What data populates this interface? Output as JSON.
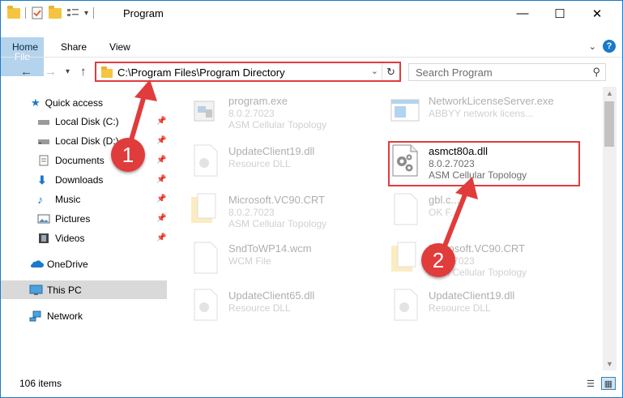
{
  "window": {
    "title": "Program",
    "controls": {
      "minimize": "—",
      "maximize": "☐",
      "close": "✕"
    }
  },
  "ribbon": {
    "tabs": [
      "File",
      "Home",
      "Share",
      "View"
    ],
    "help": "?"
  },
  "navigation": {
    "address_path": "C:\\Program Files\\Program Directory",
    "search_placeholder": "Search Program"
  },
  "sidebar": {
    "items": [
      {
        "label": "Quick access",
        "icon": "star-icon",
        "pinned": false
      },
      {
        "label": "Local Disk (C:)",
        "icon": "drive-icon",
        "pinned": true
      },
      {
        "label": "Local Disk (D:)",
        "icon": "drive-icon",
        "pinned": true
      },
      {
        "label": "Documents",
        "icon": "documents-icon",
        "pinned": true
      },
      {
        "label": "Downloads",
        "icon": "download-icon",
        "pinned": true
      },
      {
        "label": "Music",
        "icon": "music-icon",
        "pinned": true
      },
      {
        "label": "Pictures",
        "icon": "pictures-icon",
        "pinned": true
      },
      {
        "label": "Videos",
        "icon": "videos-icon",
        "pinned": true
      },
      {
        "label": "OneDrive",
        "icon": "cloud-icon",
        "pinned": false
      },
      {
        "label": "This PC",
        "icon": "computer-icon",
        "pinned": false,
        "selected": true
      },
      {
        "label": "Network",
        "icon": "network-icon",
        "pinned": false
      }
    ]
  },
  "files": [
    {
      "name": "program.exe",
      "line2": "8.0.2.7023",
      "line3": "ASM Cellular Topology",
      "icon": "exe-icon"
    },
    {
      "name": "NetworkLicenseServer.exe",
      "line2": "ABBYY network licens...",
      "line3": "",
      "icon": "exe-window-icon"
    },
    {
      "name": "UpdateClient19.dll",
      "line2": "Resource DLL",
      "line3": "",
      "icon": "dll-gear-icon"
    },
    {
      "name": "asmct80a.dll",
      "line2": "8.0.2.7023",
      "line3": "ASM Cellular Topology",
      "icon": "dll-gear-icon",
      "highlighted": true
    },
    {
      "name": "Microsoft.VC90.CRT",
      "line2": "8.0.2.7023",
      "line3": "ASM Cellular Topology",
      "icon": "folder-doc-icon"
    },
    {
      "name": "gbl.c...",
      "line2": "OK F...",
      "line3": "",
      "icon": "blank-file-icon"
    },
    {
      "name": "SndToWP14.wcm",
      "line2": "WCM File",
      "line3": "",
      "icon": "blank-file-icon"
    },
    {
      "name": "Microsoft.VC90.CRT",
      "line2": "8.0.2.7023",
      "line3": "ASM Cellular Topology",
      "icon": "folder-doc-icon"
    },
    {
      "name": "UpdateClient65.dll",
      "line2": "Resource DLL",
      "line3": "",
      "icon": "dll-gear-icon"
    },
    {
      "name": "UpdateClient19.dll",
      "line2": "Resource DLL",
      "line3": "",
      "icon": "dll-gear-icon"
    }
  ],
  "status": {
    "item_count": "106 items"
  },
  "annotations": {
    "badge1": "1",
    "badge2": "2",
    "color": "#e03c3c"
  }
}
